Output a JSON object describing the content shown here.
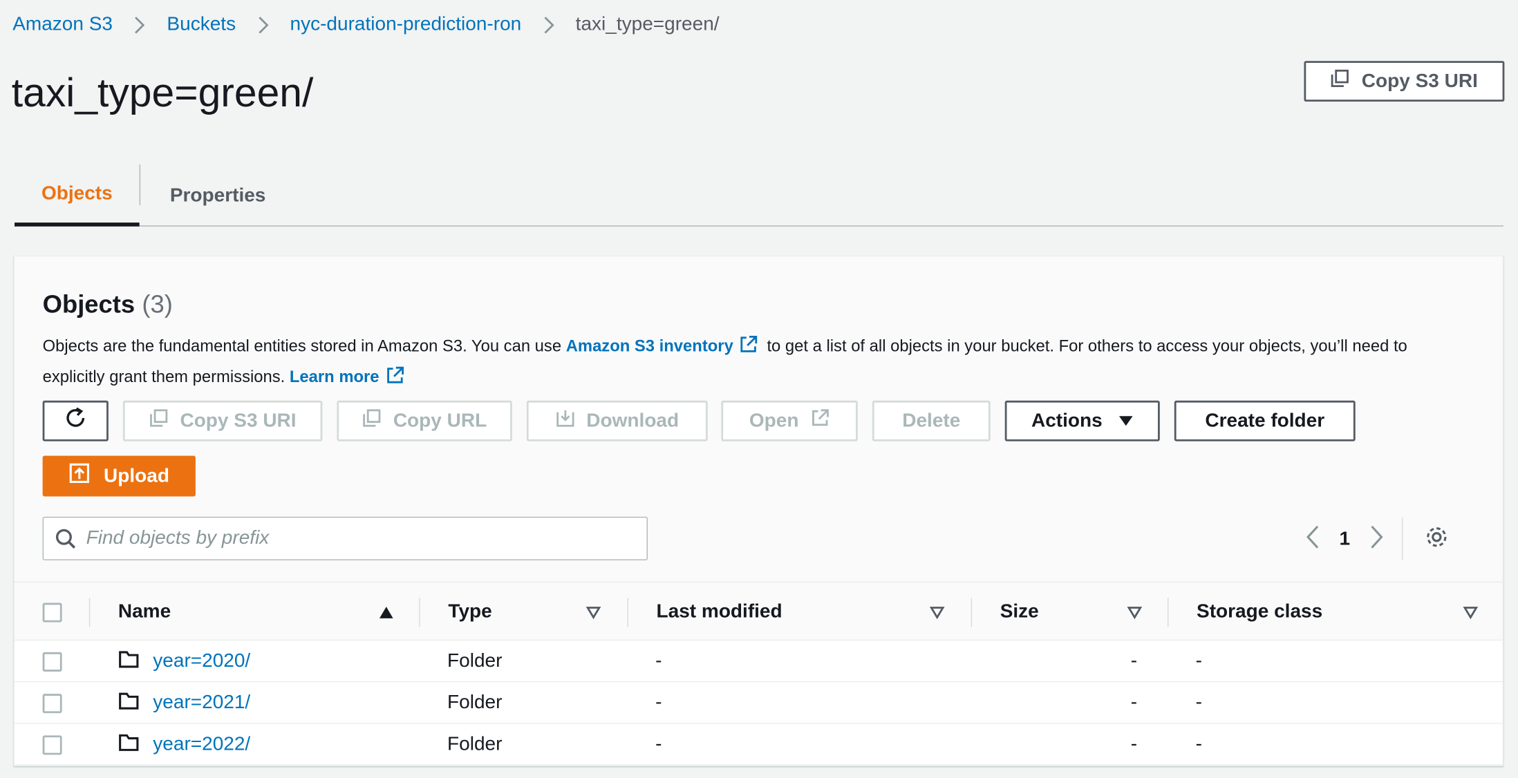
{
  "breadcrumb": {
    "items": [
      "Amazon S3",
      "Buckets",
      "nyc-duration-prediction-ron"
    ],
    "current": "taxi_type=green/"
  },
  "header": {
    "title": "taxi_type=green/",
    "copy_uri_label": "Copy S3 URI"
  },
  "tabs": [
    {
      "label": "Objects",
      "active": true
    },
    {
      "label": "Properties",
      "active": false
    }
  ],
  "objects_panel": {
    "title": "Objects",
    "count": "(3)",
    "description_part1": "Objects are the fundamental entities stored in Amazon S3. You can use ",
    "inventory_link": "Amazon S3 inventory",
    "description_part2": " to get a list of all objects in your bucket. For others to access your objects, you’ll need to explicitly grant them permissions. ",
    "learn_more": "Learn more",
    "toolbar": {
      "copy_s3_uri": "Copy S3 URI",
      "copy_url": "Copy URL",
      "download": "Download",
      "open": "Open",
      "delete": "Delete",
      "actions": "Actions",
      "create_folder": "Create folder",
      "upload": "Upload"
    },
    "search": {
      "placeholder": "Find objects by prefix",
      "value": ""
    },
    "pagination": {
      "current_page": "1"
    }
  },
  "table": {
    "columns": [
      "Name",
      "Type",
      "Last modified",
      "Size",
      "Storage class"
    ],
    "rows": [
      {
        "name": "year=2020/",
        "type": "Folder",
        "last_modified": "-",
        "size": "-",
        "storage_class": "-"
      },
      {
        "name": "year=2021/",
        "type": "Folder",
        "last_modified": "-",
        "size": "-",
        "storage_class": "-"
      },
      {
        "name": "year=2022/",
        "type": "Folder",
        "last_modified": "-",
        "size": "-",
        "storage_class": "-"
      }
    ]
  },
  "colors": {
    "link": "#0073bb",
    "accent_orange": "#ec7211",
    "text_dark": "#16191f",
    "text_gray": "#545b64",
    "disabled": "#aab7b8"
  },
  "icons": [
    "copy-icon",
    "refresh-icon",
    "download-icon",
    "external-link-icon",
    "caret-down-icon",
    "upload-icon",
    "search-icon",
    "chevron-left-icon",
    "chevron-right-icon",
    "settings-gear-icon",
    "folder-icon",
    "sort-ascending-icon",
    "sort-descending-icon",
    "chevron-right-separator-icon"
  ]
}
